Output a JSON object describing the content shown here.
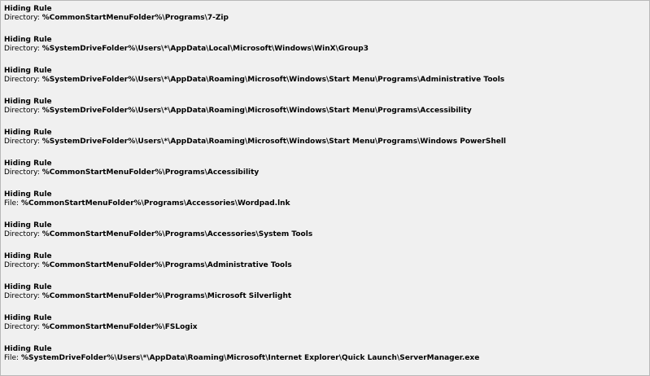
{
  "rules": [
    {
      "title": "Hiding Rule",
      "type": "Directory:",
      "path": "%CommonStartMenuFolder%\\Programs\\7-Zip"
    },
    {
      "title": "Hiding Rule",
      "type": "Directory:",
      "path": "%SystemDriveFolder%\\Users\\*\\AppData\\Local\\Microsoft\\Windows\\WinX\\Group3"
    },
    {
      "title": "Hiding Rule",
      "type": "Directory:",
      "path": "%SystemDriveFolder%\\Users\\*\\AppData\\Roaming\\Microsoft\\Windows\\Start Menu\\Programs\\Administrative Tools"
    },
    {
      "title": "Hiding Rule",
      "type": "Directory:",
      "path": "%SystemDriveFolder%\\Users\\*\\AppData\\Roaming\\Microsoft\\Windows\\Start Menu\\Programs\\Accessibility"
    },
    {
      "title": "Hiding Rule",
      "type": "Directory:",
      "path": "%SystemDriveFolder%\\Users\\*\\AppData\\Roaming\\Microsoft\\Windows\\Start Menu\\Programs\\Windows PowerShell"
    },
    {
      "title": "Hiding Rule",
      "type": "Directory:",
      "path": "%CommonStartMenuFolder%\\Programs\\Accessibility"
    },
    {
      "title": "Hiding Rule",
      "type": "File:",
      "path": "%CommonStartMenuFolder%\\Programs\\Accessories\\Wordpad.lnk"
    },
    {
      "title": "Hiding Rule",
      "type": "Directory:",
      "path": "%CommonStartMenuFolder%\\Programs\\Accessories\\System Tools"
    },
    {
      "title": "Hiding Rule",
      "type": "Directory:",
      "path": "%CommonStartMenuFolder%\\Programs\\Administrative Tools"
    },
    {
      "title": "Hiding Rule",
      "type": "Directory:",
      "path": "%CommonStartMenuFolder%\\Programs\\Microsoft Silverlight"
    },
    {
      "title": "Hiding Rule",
      "type": "Directory:",
      "path": "%CommonStartMenuFolder%\\FSLogix"
    },
    {
      "title": "Hiding Rule",
      "type": "File:",
      "path": "%SystemDriveFolder%\\Users\\*\\AppData\\Roaming\\Microsoft\\Internet Explorer\\Quick Launch\\ServerManager.exe"
    }
  ]
}
